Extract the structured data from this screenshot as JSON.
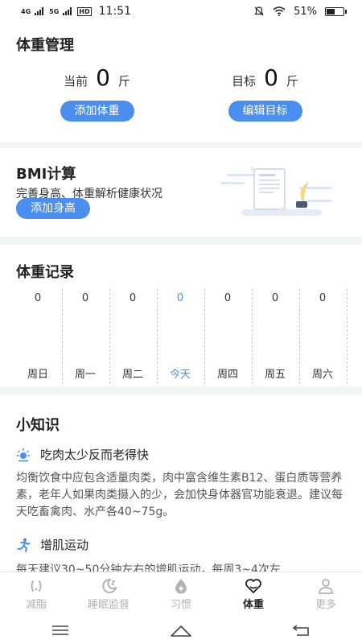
{
  "status_bar": {
    "network_1": "4G",
    "network_2": "5G",
    "hd": "HD",
    "time": "11:51",
    "battery": "51%",
    "battery_level": 0.51
  },
  "weight_management": {
    "title": "体重管理",
    "current_label": "当前",
    "current_value": "0",
    "current_unit": "斤",
    "target_label": "目标",
    "target_value": "0",
    "target_unit": "斤",
    "add_weight_button": "添加体重",
    "edit_target_button": "编辑目标"
  },
  "bmi": {
    "title": "BMI计算",
    "subtitle": "完善身高、体重解析健康状况",
    "add_height_button": "添加身高"
  },
  "weight_records": {
    "title": "体重记录",
    "days": [
      {
        "name": "周日",
        "value": "0",
        "today": false
      },
      {
        "name": "周一",
        "value": "0",
        "today": false
      },
      {
        "name": "周二",
        "value": "0",
        "today": false
      },
      {
        "name": "今天",
        "value": "0",
        "today": true
      },
      {
        "name": "周四",
        "value": "0",
        "today": false
      },
      {
        "name": "周五",
        "value": "0",
        "today": false
      },
      {
        "name": "周六",
        "value": "0",
        "today": false
      }
    ]
  },
  "tips": {
    "title": "小知识",
    "items": [
      {
        "icon": "sun-icon",
        "heading": "吃肉太少反而老得快",
        "body": "均衡饮食中应包含适量肉类，肉中富含维生素B12、蛋白质等营养素，老年人如果肉类摄入的少，会加快身体器官功能衰退。建议每天吃畜禽肉、水产各40~75g。"
      },
      {
        "icon": "running-icon",
        "heading": "增肌运动",
        "body": "每天建议30~50分钟左右的增肌运动，每周3~4次左"
      }
    ]
  },
  "tab_bar": {
    "items": [
      {
        "label": "减脂",
        "icon": "fat-loss-icon",
        "active": false
      },
      {
        "label": "睡眠监督",
        "icon": "moon-icon",
        "active": false
      },
      {
        "label": "习惯",
        "icon": "drop-icon",
        "active": false
      },
      {
        "label": "体重",
        "icon": "heart-icon",
        "active": true
      },
      {
        "label": "更多",
        "icon": "person-icon",
        "active": false
      }
    ]
  },
  "colors": {
    "accent": "#4a8ff0",
    "background": "#f2f3f5"
  }
}
